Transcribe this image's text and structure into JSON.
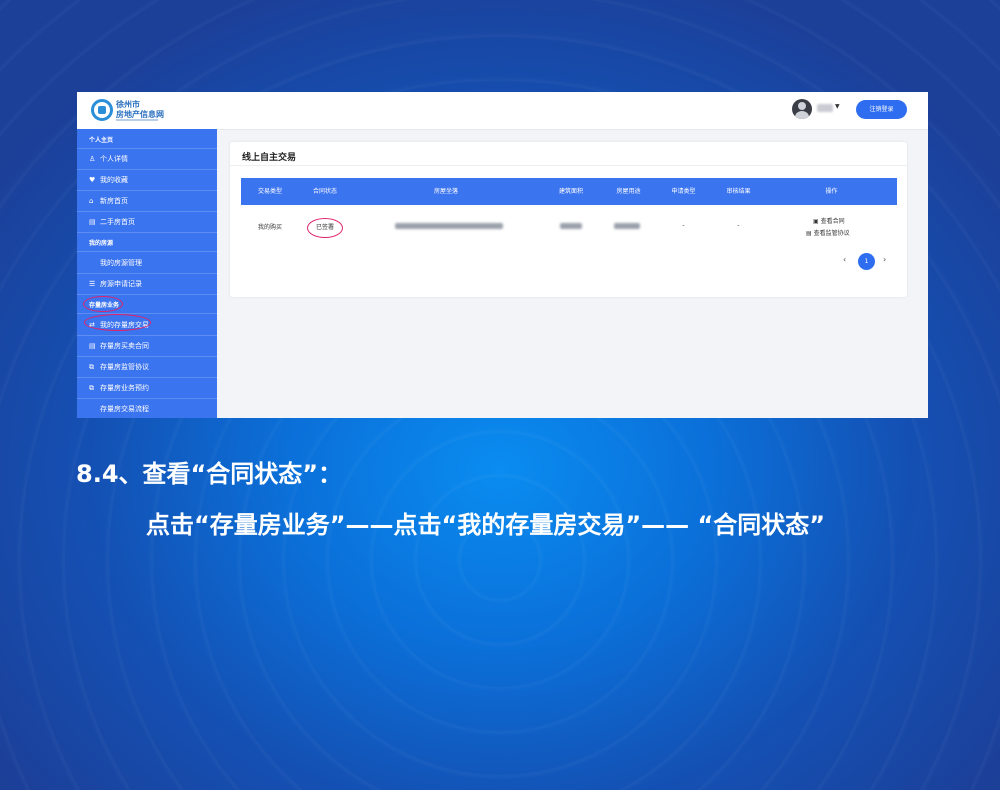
{
  "site": {
    "logo_line1": "徐州市",
    "logo_line2": "房地产信息网",
    "logout_label": "注销登录"
  },
  "sidebar": {
    "section1": "个人主页",
    "items1": [
      {
        "icon": "user-icon",
        "label": "个人详情"
      },
      {
        "icon": "heart-icon",
        "label": "我的收藏"
      },
      {
        "icon": "home-icon",
        "label": "新房首页"
      },
      {
        "icon": "document-icon",
        "label": "二手房首页"
      }
    ],
    "section2": "我的房源",
    "items2": [
      {
        "label": "我的房源管理"
      },
      {
        "icon": "list-icon",
        "label": "房源申请记录"
      }
    ],
    "section3": "存量房业务",
    "items3": [
      {
        "icon": "exchange-icon",
        "label": "我的存量房交易"
      },
      {
        "icon": "document-icon",
        "label": "存量房买卖合同"
      },
      {
        "icon": "copy-icon",
        "label": "存量房监管协议"
      },
      {
        "icon": "copy-icon",
        "label": "存量房业务预约"
      },
      {
        "label": "存量房交易流程"
      }
    ]
  },
  "panel": {
    "title": "线上自主交易",
    "columns": [
      "交易类型",
      "合同状态",
      "房屋坐落",
      "建筑面积",
      "房屋用途",
      "申请类型",
      "审核结果",
      "操作"
    ],
    "row": {
      "type": "我的购买",
      "contract_status": "已签署",
      "apply_type": "-",
      "review_result": "-",
      "action_view_contract": "查看合同",
      "action_view_agreement": "查看监管协议"
    },
    "pagination": {
      "prev": "‹",
      "current": "1",
      "next": "›"
    }
  },
  "heading": {
    "step": "8.4、查看“合同状态”：",
    "instruction": "点击“存量房业务”——点击“我的存量房交易”—— “合同状态”"
  },
  "colors": {
    "accent": "#3b74ef",
    "highlight_ring": "#e0236b"
  }
}
